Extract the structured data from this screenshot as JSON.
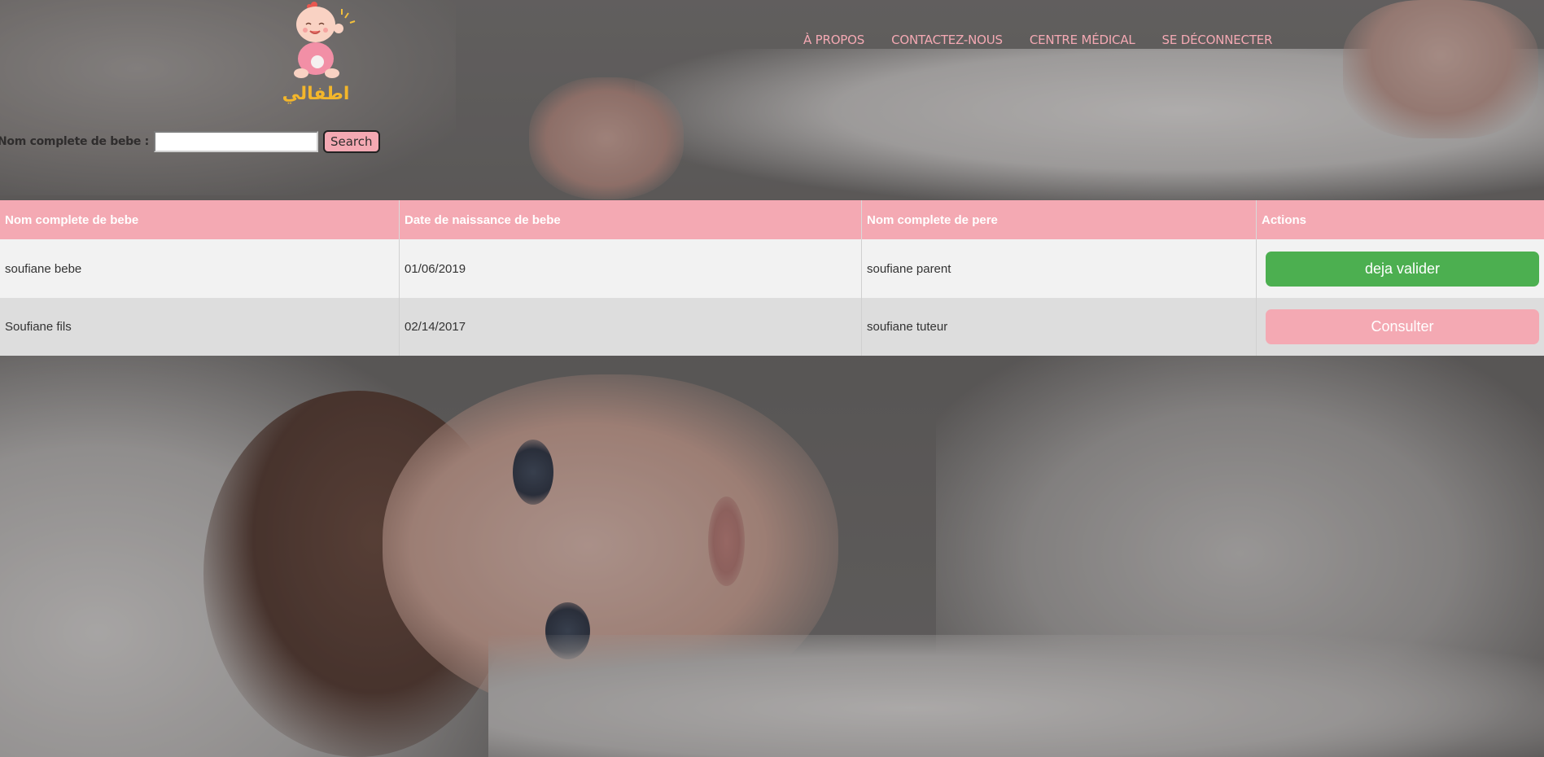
{
  "header": {
    "logo_text": "اطفالي",
    "nav": [
      {
        "label": "À PROPOS"
      },
      {
        "label": "CONTACTEZ-NOUS"
      },
      {
        "label": "CENTRE MÉDICAL"
      },
      {
        "label": "SE DÉCONNECTER"
      }
    ]
  },
  "search": {
    "label": "Nom complete de bebe :",
    "value": "",
    "button_label": "Search"
  },
  "table": {
    "headers": [
      "Nom complete de bebe",
      "Date de naissance de bebe",
      "Nom complete de pere",
      "Actions"
    ],
    "rows": [
      {
        "bebe": "soufiane bebe",
        "date": "01/06/2019",
        "pere": "soufiane parent",
        "action": "deja valider",
        "action_color": "#4caf50"
      },
      {
        "bebe": "Soufiane fils",
        "date": "02/14/2017",
        "pere": "soufiane tuteur",
        "action": "Consulter",
        "action_color": "#f4a9b3"
      }
    ]
  },
  "colors": {
    "accent": "#f4a9b3",
    "success": "#4caf50"
  }
}
